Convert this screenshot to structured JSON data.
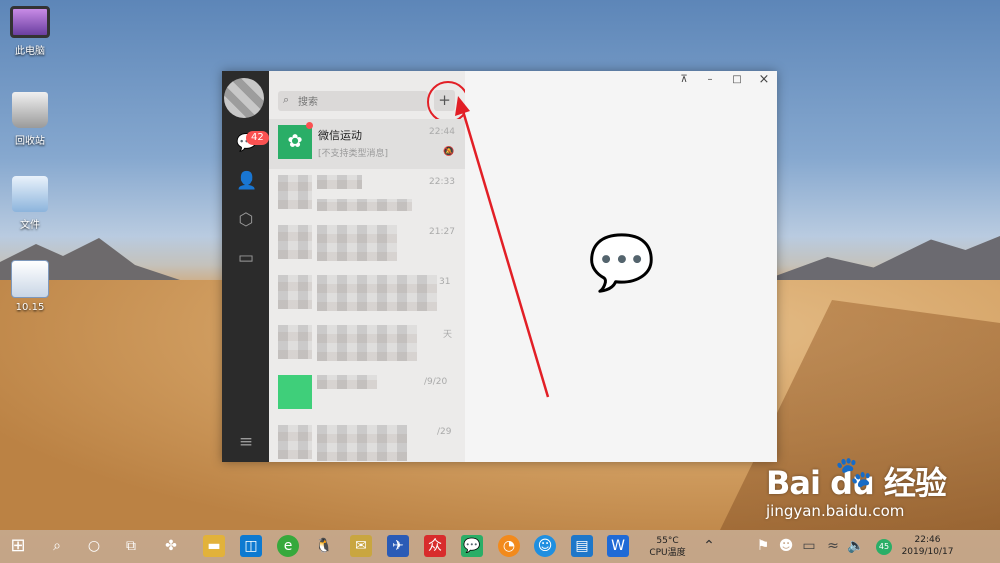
{
  "desktop": {
    "icons": [
      {
        "label": "此电脑",
        "icon": "monitor-icon"
      },
      {
        "label": "回收站",
        "icon": "recycle-bin-icon"
      },
      {
        "label": "文件",
        "icon": "folder-icon"
      },
      {
        "label": "10.15",
        "icon": "word-doc-icon"
      }
    ]
  },
  "wechat": {
    "unread_badge": "42",
    "search": {
      "placeholder": "搜索"
    },
    "add_button": "+",
    "chats": [
      {
        "name": "微信运动",
        "message": "[不支持类型消息]",
        "time": "22:44"
      },
      {
        "name": "",
        "message": "",
        "time": "22:33"
      },
      {
        "name": "",
        "message": "",
        "time": "21:27"
      },
      {
        "name": "",
        "message": "",
        "time": "31"
      },
      {
        "name": "",
        "message": "",
        "time": "天"
      },
      {
        "name": "",
        "message": "",
        "time": "/9/20"
      },
      {
        "name": "",
        "message": "",
        "time": "/29"
      }
    ],
    "window_controls": {
      "pin": "⊼",
      "minimize": "–",
      "maximize": "□",
      "close": "×"
    }
  },
  "taskbar": {
    "temp": "55°C",
    "cpu": "CPU温度",
    "notify_count": "45",
    "time": "22:46",
    "date": "2019/10/17"
  },
  "watermark": {
    "main": "Bai du 经验",
    "sub": "jingyan.baidu.com"
  },
  "colors": {
    "accent": "#1aad19",
    "badge": "#fa5151",
    "annotation": "#e21f26"
  }
}
